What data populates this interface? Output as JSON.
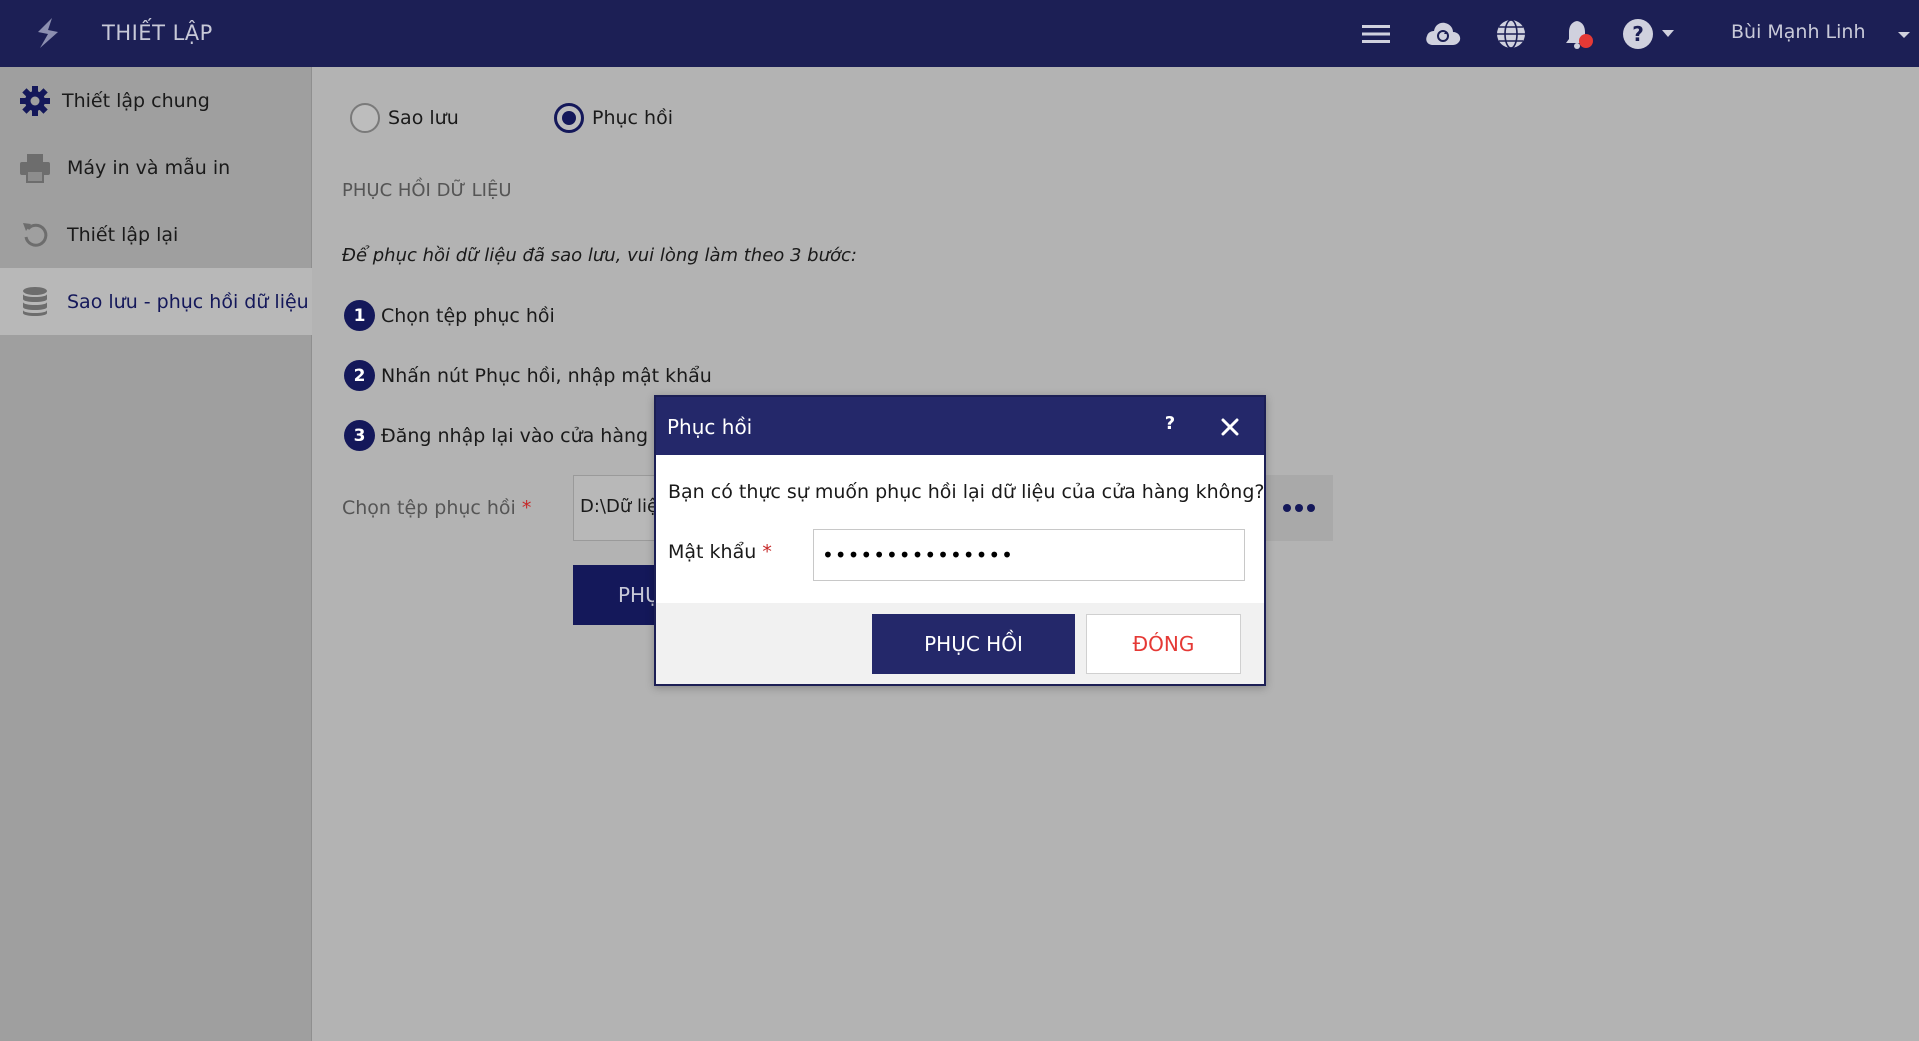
{
  "header": {
    "title": "THIẾT LẬP",
    "user_name": "Bùi Mạnh Linh",
    "icons": [
      "menu-icon",
      "cloud-sync-icon",
      "globe-icon",
      "bell-icon",
      "help-icon"
    ],
    "colors": {
      "bar": "#1c1f55",
      "notification_dot": "#e53935"
    }
  },
  "sidebar": {
    "items": [
      {
        "label": "Thiết lập chung",
        "icon": "gear-icon"
      },
      {
        "label": "Máy in và mẫu in",
        "icon": "printer-icon"
      },
      {
        "label": "Thiết lập lại",
        "icon": "reset-icon"
      },
      {
        "label": "Sao lưu - phục hồi dữ liệu",
        "icon": "database-icon",
        "active": true
      }
    ]
  },
  "main": {
    "mode_options": [
      {
        "label": "Sao lưu",
        "checked": false
      },
      {
        "label": "Phục hồi",
        "checked": true
      }
    ],
    "section_title": "PHỤC HỒI DỮ LIỆU",
    "instruction": "Để phục hồi dữ liệu đã sao lưu, vui lòng làm theo 3 bước:",
    "steps": [
      {
        "num": "1",
        "text": "Chọn tệp phục hồi"
      },
      {
        "num": "2",
        "text": "Nhấn nút Phục hồi, nhập mật khẩu"
      },
      {
        "num": "3",
        "text": "Đăng nhập lại vào cửa hàng mu"
      }
    ],
    "file_label": "Chọn tệp phục hồi",
    "required_mark": "*",
    "file_value": "D:\\Dữ liệ",
    "restore_button": "PHỤ"
  },
  "dialog": {
    "title": "Phục hồi",
    "help": "?",
    "question": "Bạn có thực sự muốn phục hồi lại dữ liệu của cửa hàng không?",
    "password_label": "Mật khẩu",
    "required_mark": "*",
    "password_value": "123456789012345",
    "ok_label": "PHỤC HỒI",
    "cancel_label": "ĐÓNG",
    "colors": {
      "header": "#24286a",
      "cancel_text": "#e53935"
    }
  }
}
